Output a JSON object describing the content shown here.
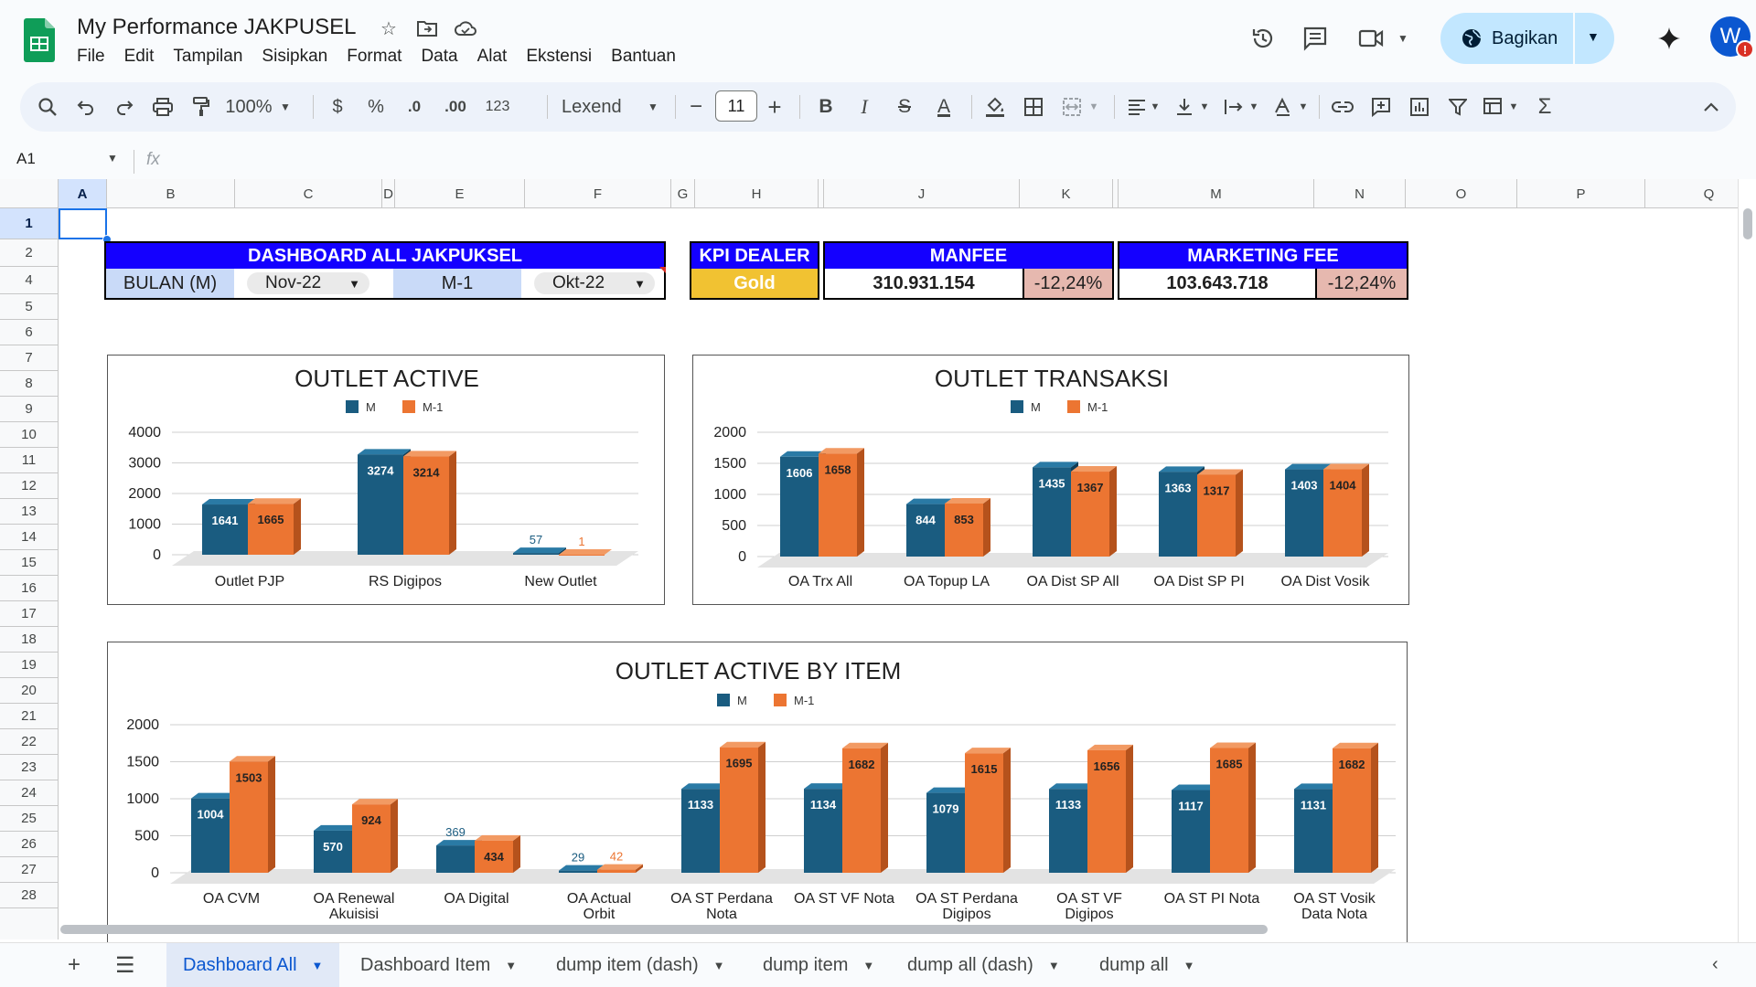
{
  "app": {
    "title": "My Performance JAKPUSEL",
    "menu": [
      "File",
      "Edit",
      "Tampilan",
      "Sisipkan",
      "Format",
      "Data",
      "Alat",
      "Ekstensi",
      "Bantuan"
    ],
    "share_label": "Bagikan",
    "avatar_letter": "W",
    "avatar_badge": "!"
  },
  "toolbar": {
    "zoom": "100%",
    "currency": "$",
    "percent": "%",
    "dec_decrease": ".0",
    "dec_increase": ".00",
    "format_123": "123",
    "font": "Lexend",
    "font_size": "11",
    "minus": "−",
    "plus": "+",
    "bold": "B",
    "italic": "I",
    "strike": "S",
    "text_color": "A",
    "sigma": "Σ"
  },
  "formula": {
    "namebox": "A1",
    "fx": "fx"
  },
  "columns": [
    "A",
    "B",
    "C",
    "D",
    "E",
    "F",
    "G",
    "H",
    "",
    "J",
    "K",
    "",
    "M",
    "N",
    "O",
    "P",
    "Q"
  ],
  "rows": [
    "1",
    "2",
    "4",
    "5",
    "6",
    "7",
    "8",
    "9",
    "10",
    "11",
    "12",
    "13",
    "14",
    "15",
    "16",
    "17",
    "18",
    "19",
    "20",
    "21",
    "22",
    "23",
    "24",
    "25",
    "26",
    "27",
    "28"
  ],
  "dashboard": {
    "title": "DASHBOARD ALL JAKPUKSEL",
    "bulan_label": "BULAN (M)",
    "bulan_value": "Nov-22",
    "m1_label": "M-1",
    "m1_value": "Okt-22",
    "kpi_title": "KPI DEALER",
    "kpi_value": "Gold",
    "manfee_title": "MANFEE",
    "manfee_value": "310.931.154",
    "manfee_change": "-12,24%",
    "mfee_title": "MARKETING FEE",
    "mfee_value": "103.643.718",
    "mfee_change": "-12,24%"
  },
  "colors": {
    "m": "#1a5c80",
    "m1": "#ec7532",
    "header_blue": "#1400ff",
    "gold": "#f1c232",
    "neg": "#e6b8af"
  },
  "chart_data": [
    {
      "type": "bar",
      "title": "OUTLET ACTIVE",
      "categories": [
        "Outlet PJP",
        "RS Digipos",
        "New Outlet"
      ],
      "series": [
        {
          "name": "M",
          "values": [
            1641,
            3274,
            57
          ]
        },
        {
          "name": "M-1",
          "values": [
            1665,
            3214,
            1
          ]
        }
      ],
      "yticks": [
        0,
        1000,
        2000,
        3000,
        4000
      ],
      "ylim": [
        0,
        4000
      ],
      "legend": "top"
    },
    {
      "type": "bar",
      "title": "OUTLET TRANSAKSI",
      "categories": [
        "OA Trx All",
        "OA Topup LA",
        "OA Dist SP All",
        "OA Dist SP PI",
        "OA Dist Vosik"
      ],
      "series": [
        {
          "name": "M",
          "values": [
            1606,
            844,
            1435,
            1363,
            1403
          ]
        },
        {
          "name": "M-1",
          "values": [
            1658,
            853,
            1367,
            1317,
            1404
          ]
        }
      ],
      "yticks": [
        0,
        500,
        1000,
        1500,
        2000
      ],
      "ylim": [
        0,
        2000
      ],
      "legend": "top"
    },
    {
      "type": "bar",
      "title": "OUTLET ACTIVE BY ITEM",
      "categories": [
        "OA CVM",
        "OA Renewal Akuisisi",
        "OA Digital",
        "OA Actual Orbit",
        "OA ST Perdana Nota",
        "OA ST VF Nota",
        "OA ST Perdana Digipos",
        "OA ST VF Digipos",
        "OA ST PI Nota",
        "OA ST Vosik Data Nota"
      ],
      "series": [
        {
          "name": "M",
          "values": [
            1004,
            570,
            369,
            29,
            1133,
            1134,
            1079,
            1133,
            1117,
            1131
          ]
        },
        {
          "name": "M-1",
          "values": [
            1503,
            924,
            434,
            42,
            1695,
            1682,
            1615,
            1656,
            1685,
            1682
          ]
        }
      ],
      "yticks": [
        0,
        500,
        1000,
        1500,
        2000
      ],
      "ylim": [
        0,
        2000
      ],
      "legend": "top"
    }
  ],
  "sheets": [
    {
      "name": "Dashboard All",
      "active": true
    },
    {
      "name": "Dashboard Item",
      "active": false
    },
    {
      "name": "dump item (dash)",
      "active": false
    },
    {
      "name": "dump item",
      "active": false
    },
    {
      "name": "dump all (dash)",
      "active": false
    },
    {
      "name": "dump all",
      "active": false
    }
  ]
}
